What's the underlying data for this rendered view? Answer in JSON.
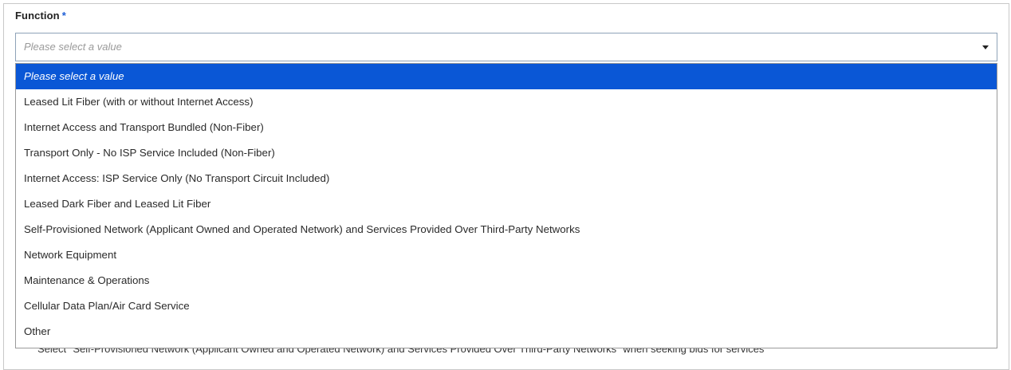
{
  "field": {
    "label": "Function",
    "required_marker": "*",
    "placeholder": "Please select a value"
  },
  "dropdown": {
    "options": [
      "Please select a value",
      "Leased Lit Fiber (with or without Internet Access)",
      "Internet Access and Transport Bundled (Non-Fiber)",
      "Transport Only - No ISP Service Included (Non-Fiber)",
      "Internet Access: ISP Service Only (No Transport Circuit Included)",
      "Leased Dark Fiber and Leased Lit Fiber",
      "Self-Provisioned Network (Applicant Owned and Operated Network) and Services Provided Over Third-Party Networks",
      "Network Equipment",
      "Maintenance & Operations",
      "Cellular Data Plan/Air Card Service",
      "Other"
    ],
    "highlighted_index": 0
  },
  "background_note": "Select \"Self-Provisioned Network (Applicant Owned and Operated Network) and Services Provided Over Third-Party Networks\" when seeking bids for services",
  "colors": {
    "highlight": "#0a57d6",
    "required_marker": "#1f5fd6"
  },
  "icons": {
    "select_caret": "caret-down-icon"
  }
}
